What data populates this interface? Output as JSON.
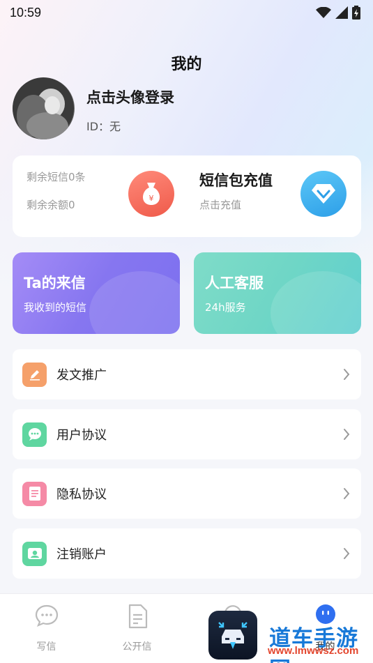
{
  "status_bar": {
    "time": "10:59"
  },
  "page": {
    "title": "我的"
  },
  "profile": {
    "login_text": "点击头像登录",
    "id_text": "ID：无"
  },
  "balance": {
    "sms_remaining": "剩余短信0条",
    "balance_remaining": "剩余余额0",
    "coin_symbol": "¥",
    "recharge_title": "短信包充值",
    "recharge_sub": "点击充值"
  },
  "features": [
    {
      "title": "Ta的来信",
      "subtitle": "我收到的短信",
      "color": "#8a7cf2"
    },
    {
      "title": "人工客服",
      "subtitle": "24h服务",
      "color": "#6fd6c6"
    }
  ],
  "menu": [
    {
      "label": "发文推广",
      "icon": "pencil-icon",
      "color": "#f5a06a"
    },
    {
      "label": "用户协议",
      "icon": "chat-bubble-icon",
      "color": "#5fd6a0"
    },
    {
      "label": "隐私协议",
      "icon": "document-icon",
      "color": "#f58aa6"
    },
    {
      "label": "注销账户",
      "icon": "account-cancel-icon",
      "color": "#5fd6a0"
    }
  ],
  "tabs": [
    {
      "label": "写信",
      "icon": "chat-icon",
      "active": false
    },
    {
      "label": "公开信",
      "icon": "letter-icon",
      "active": false
    },
    {
      "label": "",
      "icon": "refresh-icon",
      "active": false
    },
    {
      "label": "我的",
      "icon": "profile-face-icon",
      "active": true
    }
  ],
  "watermark": {
    "text": "道车手游网",
    "url": "www.lmwwsz.com"
  },
  "colors": {
    "accent": "#2f6ff0",
    "purple": "#8a7cf2",
    "teal": "#6fd6c6"
  }
}
